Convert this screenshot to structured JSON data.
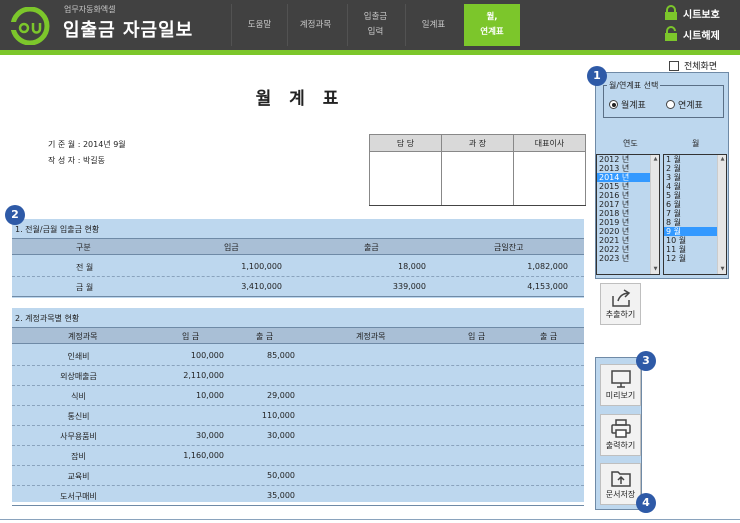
{
  "header": {
    "subtitle": "업무자동화엑셀",
    "title": "입출금 자금일보",
    "menu": [
      {
        "label": "도움말"
      },
      {
        "label": "계정과목"
      },
      {
        "label": "입출금\n입력"
      },
      {
        "label": "일계표"
      },
      {
        "label": "월,\n연계표",
        "active": true
      }
    ],
    "sheet_protect": "시트보호",
    "sheet_unprotect": "시트해제"
  },
  "fullscreen_label": "전체화면",
  "report": {
    "title": "월 계 표",
    "base_month": "기 준 월 : 2014년 9월",
    "author": "작 성 자 : 박길동",
    "approval": [
      "담 당",
      "과 장",
      "대표이사"
    ]
  },
  "section1": {
    "label": "1. 전월/금월 입출금 현황",
    "headers": [
      "구분",
      "입금",
      "출금",
      "금일잔고"
    ],
    "rows": [
      {
        "cat": "전 월",
        "in": "1,100,000",
        "out": "18,000",
        "bal": "1,082,000"
      },
      {
        "cat": "금 월",
        "in": "3,410,000",
        "out": "339,000",
        "bal": "4,153,000"
      }
    ]
  },
  "section2": {
    "label": "2. 계정과목별 현황",
    "headers": [
      "계정과목",
      "입 금",
      "출 금",
      "계정과목",
      "입 금",
      "출 금"
    ],
    "rows": [
      {
        "acct": "인쇄비",
        "in": "100,000",
        "out": "85,000"
      },
      {
        "acct": "외상매출금",
        "in": "2,110,000",
        "out": ""
      },
      {
        "acct": "식비",
        "in": "10,000",
        "out": "29,000"
      },
      {
        "acct": "통신비",
        "in": "",
        "out": "110,000"
      },
      {
        "acct": "사무용품비",
        "in": "30,000",
        "out": "30,000"
      },
      {
        "acct": "잡비",
        "in": "1,160,000",
        "out": ""
      },
      {
        "acct": "교육비",
        "in": "",
        "out": "50,000"
      },
      {
        "acct": "도서구매비",
        "in": "",
        "out": "35,000"
      }
    ]
  },
  "panel": {
    "group_title": "월/연계표 선택",
    "radio_monthly": "월계표",
    "radio_yearly": "연계표",
    "year_head": "연도",
    "month_head": "월",
    "years": [
      "2012 년",
      "2013 년",
      "2014 년",
      "2015 년",
      "2016 년",
      "2017 년",
      "2018 년",
      "2019 년",
      "2020 년",
      "2021 년",
      "2022 년",
      "2023 년"
    ],
    "months": [
      "1 월",
      "2 월",
      "3 월",
      "4 월",
      "5 월",
      "6 월",
      "7 월",
      "8 월",
      "9 월",
      "10 월",
      "11 월",
      "12 월"
    ],
    "selected_year": "2014 년",
    "selected_month": "9 월",
    "extract_label": "추출하기",
    "preview_label": "미리보기",
    "print_label": "출력하기",
    "save_label": "문서저장"
  },
  "badges": [
    "1",
    "2",
    "3",
    "4"
  ],
  "colors": {
    "header_bg": "#414141",
    "accent": "#7cc62b",
    "panel_blue": "#bdd7ee",
    "badge": "#2e5aa7"
  }
}
